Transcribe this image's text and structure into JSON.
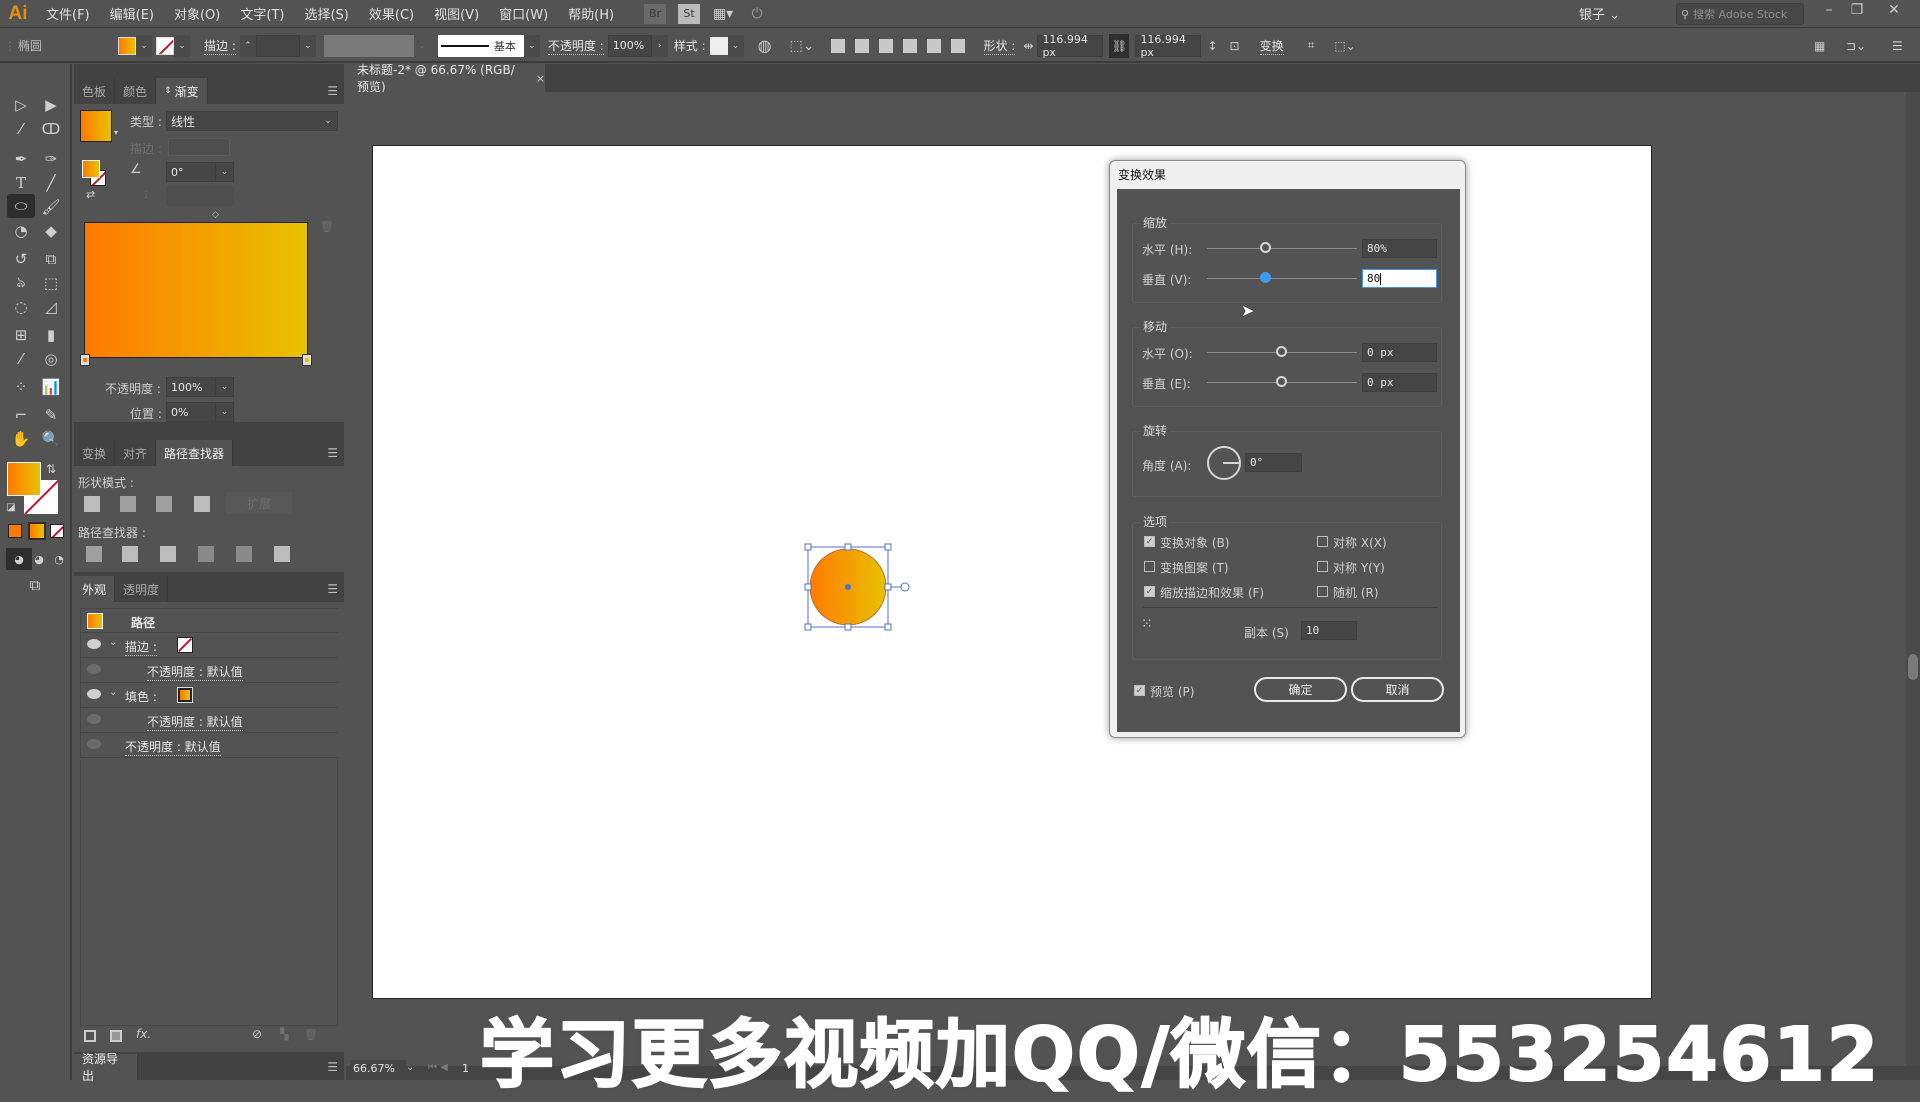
{
  "app": {
    "logo": "Ai"
  },
  "menubar": {
    "items": [
      "文件(F)",
      "编辑(E)",
      "对象(O)",
      "文字(T)",
      "选择(S)",
      "效果(C)",
      "视图(V)",
      "窗口(W)",
      "帮助(H)"
    ],
    "bridge_icon": "Br",
    "stock_icon": "St",
    "workspace": "银子",
    "search_placeholder": "搜索 Adobe Stock"
  },
  "controlbar": {
    "object_type": "椭圆",
    "stroke_label": "描边 :",
    "stroke_style": "基本",
    "opacity_label": "不透明度 :",
    "opacity_value": "100%",
    "style_label": "样式 :",
    "shape_label": "形状 :",
    "width_value": "116.994 px",
    "height_value": "116.994 px",
    "transform_label": "变换"
  },
  "document_tab": {
    "title": "未标题-2* @ 66.67% (RGB/预览)",
    "close": "×"
  },
  "gradient_panel": {
    "tabs": [
      "色板",
      "颜色",
      "渐变"
    ],
    "active_tab": "渐变",
    "type_label": "类型 :",
    "type_value": "线性",
    "stroke_label": "描边 :",
    "angle_value": "0°",
    "opacity_label": "不透明度 :",
    "opacity_value": "100%",
    "location_label": "位置 :",
    "location_value": "0%",
    "gradient_start": "#ff7a00",
    "gradient_end": "#e8c200"
  },
  "pathfinder_panel": {
    "tabs": [
      "变换",
      "对齐",
      "路径查找器"
    ],
    "active_tab": "路径查找器",
    "shape_modes_label": "形状模式 :",
    "expand_label": "扩展",
    "pathfinders_label": "路径查找器 :"
  },
  "appearance_panel": {
    "tabs": [
      "外观",
      "透明度"
    ],
    "active_tab": "外观",
    "header": "路径",
    "rows": [
      {
        "label": "描边 :",
        "visible": true,
        "indent": 1
      },
      {
        "label": "不透明度 : 默认值",
        "visible": false,
        "indent": 2
      },
      {
        "label": "填色 :",
        "visible": true,
        "indent": 1
      },
      {
        "label": "不透明度 : 默认值",
        "visible": false,
        "indent": 2
      },
      {
        "label": "不透明度 : 默认值",
        "visible": false,
        "indent": 1
      }
    ],
    "fx_label": "fx."
  },
  "asset_export_panel": {
    "tab": "资源导出"
  },
  "status": {
    "zoom": "66.67%",
    "page": "1"
  },
  "dialog": {
    "title": "变换效果",
    "scale": {
      "title": "缩放",
      "horizontal_label": "水平 (H):",
      "horizontal_value": "80%",
      "horizontal_fraction": 0.4,
      "vertical_label": "垂直 (V):",
      "vertical_value": "80",
      "vertical_fraction": 0.4
    },
    "move": {
      "title": "移动",
      "horizontal_label": "水平 (O):",
      "horizontal_value": "0 px",
      "vertical_label": "垂直 (E):",
      "vertical_value": "0 px"
    },
    "rotate": {
      "title": "旋转",
      "angle_label": "角度 (A):",
      "angle_value": "0°"
    },
    "options": {
      "title": "选项",
      "transform_objects": {
        "label": "变换对象 (B)",
        "checked": true
      },
      "transform_patterns": {
        "label": "变换图案 (T)",
        "checked": false
      },
      "scale_strokes": {
        "label": "缩放描边和效果 (F)",
        "checked": true
      },
      "reflect_x": {
        "label": "对称 X(X)",
        "checked": false
      },
      "reflect_y": {
        "label": "对称 Y(Y)",
        "checked": false
      },
      "random": {
        "label": "随机 (R)",
        "checked": false
      },
      "copies_label": "副本 (S)",
      "copies_value": "10"
    },
    "preview": {
      "label": "预览 (P)",
      "checked": true
    },
    "ok_label": "确定",
    "cancel_label": "取消"
  },
  "watermark": "学习更多视频加QQ/微信：553254612"
}
